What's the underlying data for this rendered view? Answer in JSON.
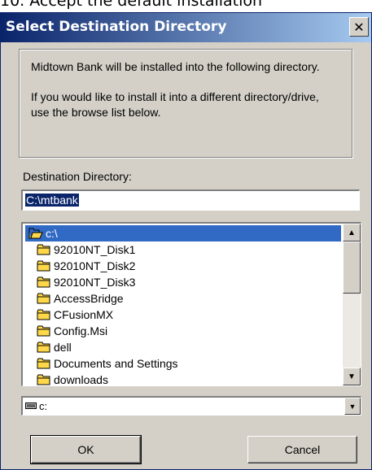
{
  "document_header": "10.    Accept the default installation",
  "dialog": {
    "title": "Select Destination Directory",
    "close_symbol": "✕",
    "info": {
      "line1": "Midtown Bank will be installed into the following directory.",
      "line2": "If you would like to install it into a different directory/drive, use the browse list below."
    },
    "destination_label": "Destination Directory:",
    "destination_value": "C:\\mtbank",
    "directory_list": {
      "root": "c:\\",
      "items": [
        "92010NT_Disk1",
        "92010NT_Disk2",
        "92010NT_Disk3",
        "AccessBridge",
        "CFusionMX",
        "Config.Msi",
        "dell",
        "Documents and Settings",
        "downloads"
      ],
      "selected": "c:\\"
    },
    "drive": "c:",
    "buttons": {
      "ok": "OK",
      "cancel": "Cancel"
    }
  },
  "icons": {
    "folder": "folder-icon",
    "open_folder": "open-folder-icon",
    "drive": "drive-icon",
    "close": "close-icon",
    "scroll_up": "arrow-up-icon",
    "scroll_down": "arrow-down-icon",
    "dropdown": "chevron-down-icon"
  },
  "colors": {
    "title_bar": "#0a246a",
    "selection": "#316ac5",
    "dialog_bg": "#d4d0c8",
    "folder_yellow": "#ffd84a"
  }
}
